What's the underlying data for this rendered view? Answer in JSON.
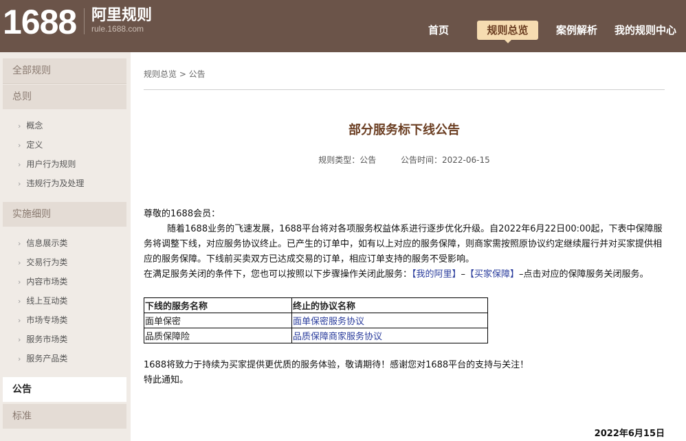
{
  "header": {
    "logo_text": "1688",
    "site_title": "阿里规则",
    "site_url": "rule.1688.com",
    "nav": {
      "home": "首页",
      "rules_overview": "规则总览",
      "case_analysis": "案例解析",
      "my_rule_center": "我的规则中心"
    },
    "colors": {
      "header_bg": "#6b5449",
      "active_tab_bg": "#f6dcb1"
    }
  },
  "sidebar": {
    "all_rules": "全部规则",
    "general": "总则",
    "general_items": [
      "概念",
      "定义",
      "用户行为规则",
      "违规行为及处理"
    ],
    "implementation": "实施细则",
    "implementation_items": [
      "信息展示类",
      "交易行为类",
      "内容市场类",
      "线上互动类",
      "市场专场类",
      "服务市场类",
      "服务产品类"
    ],
    "announcement": "公告",
    "standard": "标准"
  },
  "content": {
    "breadcrumb": "规则总览 > 公告",
    "title": "部分服务标下线公告",
    "meta_type_label": "规则类型：",
    "meta_type_value": "公告",
    "meta_time_label": "公告时间：",
    "meta_time_value": "2022-06-15",
    "greeting": "尊敬的1688会员：",
    "paragraph1": "随着1688业务的飞速发展，1688平台将对各项服务权益体系进行逐步优化升级。自2022年6月22日00:00起，下表中保障服务将调整下线，对应服务协议终止。已产生的订单中，如有以上对应的服务保障，则商家需按照原协议约定继续履行并对买家提供相应的服务保障。下线前买卖双方已达成交易的订单，相应订单支持的服务不受影响。",
    "paragraph2_prefix": "在满足服务关闭的条件下，您也可以按照以下步骤操作关闭此服务：",
    "paragraph2_link1": "【我的阿里】",
    "paragraph2_dash": "–",
    "paragraph2_link2": "【买家保障】",
    "paragraph2_suffix": "–点击对应的保障服务关闭服务。",
    "table": {
      "headers": [
        "下线的服务名称",
        "终止的协议名称"
      ],
      "rows": [
        [
          "面单保密",
          "面单保密服务协议"
        ],
        [
          "品质保障险",
          "品质保障商家服务协议"
        ]
      ]
    },
    "closing": "1688将致力于持续为买家提供更优质的服务体验，敬请期待！感谢您对1688平台的支持与关注！",
    "notice": "特此通知。",
    "date": "2022年6月15日"
  }
}
